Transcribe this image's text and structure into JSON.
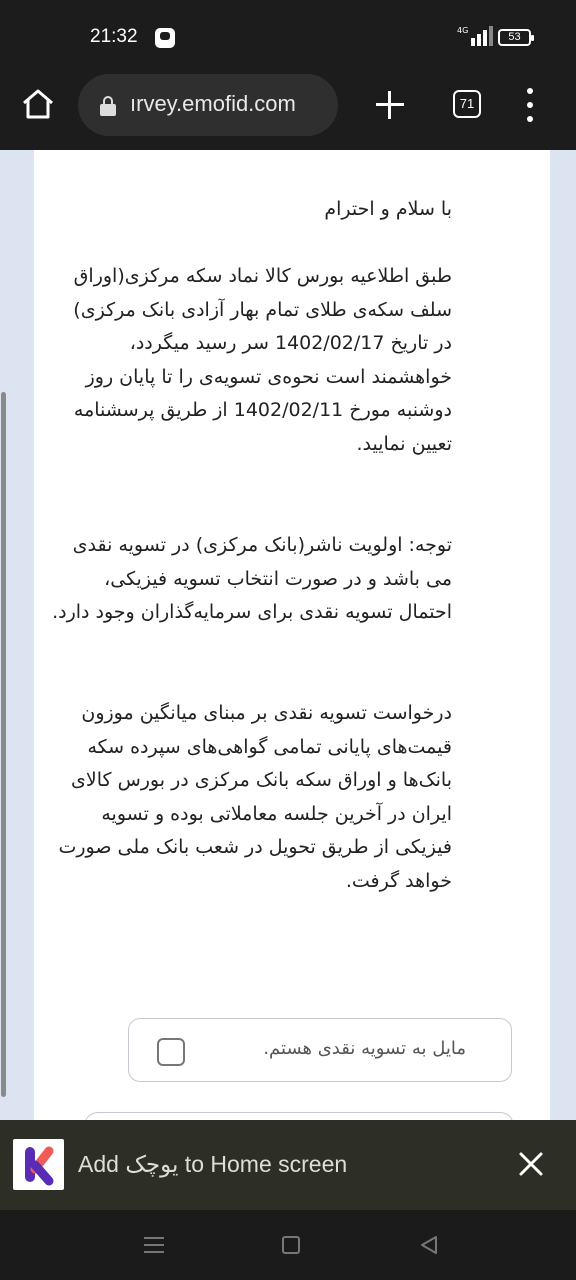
{
  "status_bar": {
    "time": "21:32",
    "network": "4G",
    "battery": "53",
    "icons": [
      "notification-icon",
      "signal-icon",
      "battery-icon"
    ]
  },
  "browser": {
    "url": "ırvey.emofid.com",
    "tab_count": "71",
    "icons": [
      "home-icon",
      "lock-icon",
      "new-tab-icon",
      "tab-switcher-icon",
      "overflow-menu-icon"
    ]
  },
  "page": {
    "greeting": "با سلام و احترام",
    "paragraph_1": "طبق اطلاعیه بورس کالا نماد سکه مرکزی(اوراق سلف سکه‌ی طلای تمام بهار آزادی بانک مرکزی) در تاریخ 1402/02/17 سر رسید میگردد، خواهشمند است نحوه‌ی تسویه‌ی را تا پایان روز دوشنبه مورخ 1402/02/11 از طریق پرسشنامه تعیین نمایید.",
    "paragraph_2": "توجه: اولویت ناشر(بانک مرکزی) در تسویه نقدی می باشد و در صورت انتخاب تسویه فیزیکی، احتمال تسویه نقدی برای سرمایه‌گذاران وجود دارد.",
    "paragraph_3": "درخواست تسویه نقدی بر مبنای میانگین موزون قیمت‌های پایانی تمامی گواهی‌های سپرده سکه بانک‌ها و اوراق سکه بانک مرکزی در بورس کالای ایران در آخرین جلسه معاملاتی بوده و تسویه فیزیکی از طریق تحویل در شعب بانک ملی صورت خواهد گرفت.",
    "option_1_label": "مایل به تسویه نقدی هستم.",
    "option_1_checked": false
  },
  "a2hs": {
    "text": "Add یوچک to Home screen",
    "icons": [
      "app-icon",
      "close-icon"
    ]
  },
  "colors": {
    "chrome_bg": "#1c1c1c",
    "page_bg": "#dce4f2",
    "card_bg": "#ffffff",
    "banner_bg": "#2d2f26",
    "app_icon_purple": "#5a2bb5",
    "app_icon_red": "#f15b57"
  }
}
